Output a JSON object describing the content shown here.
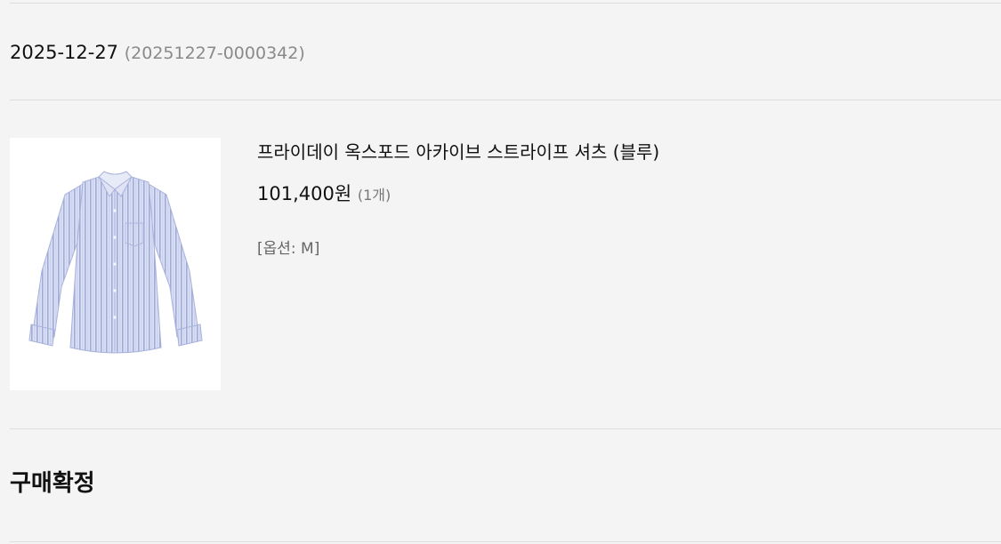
{
  "order": {
    "date": "2025-12-27",
    "number": "(20251227-0000342)"
  },
  "product": {
    "image_icon": "shirt-image",
    "name": "프라이데이 옥스포드 아카이브 스트라이프 셔츠 (블루)",
    "price": "101,400원",
    "quantity": "(1개)",
    "option": "[옵션: M]"
  },
  "status": {
    "label": "구매확정"
  },
  "colors": {
    "background": "#f4f4f5",
    "shirt": "#d6dcf0",
    "stripe": "#9aa6d8"
  }
}
